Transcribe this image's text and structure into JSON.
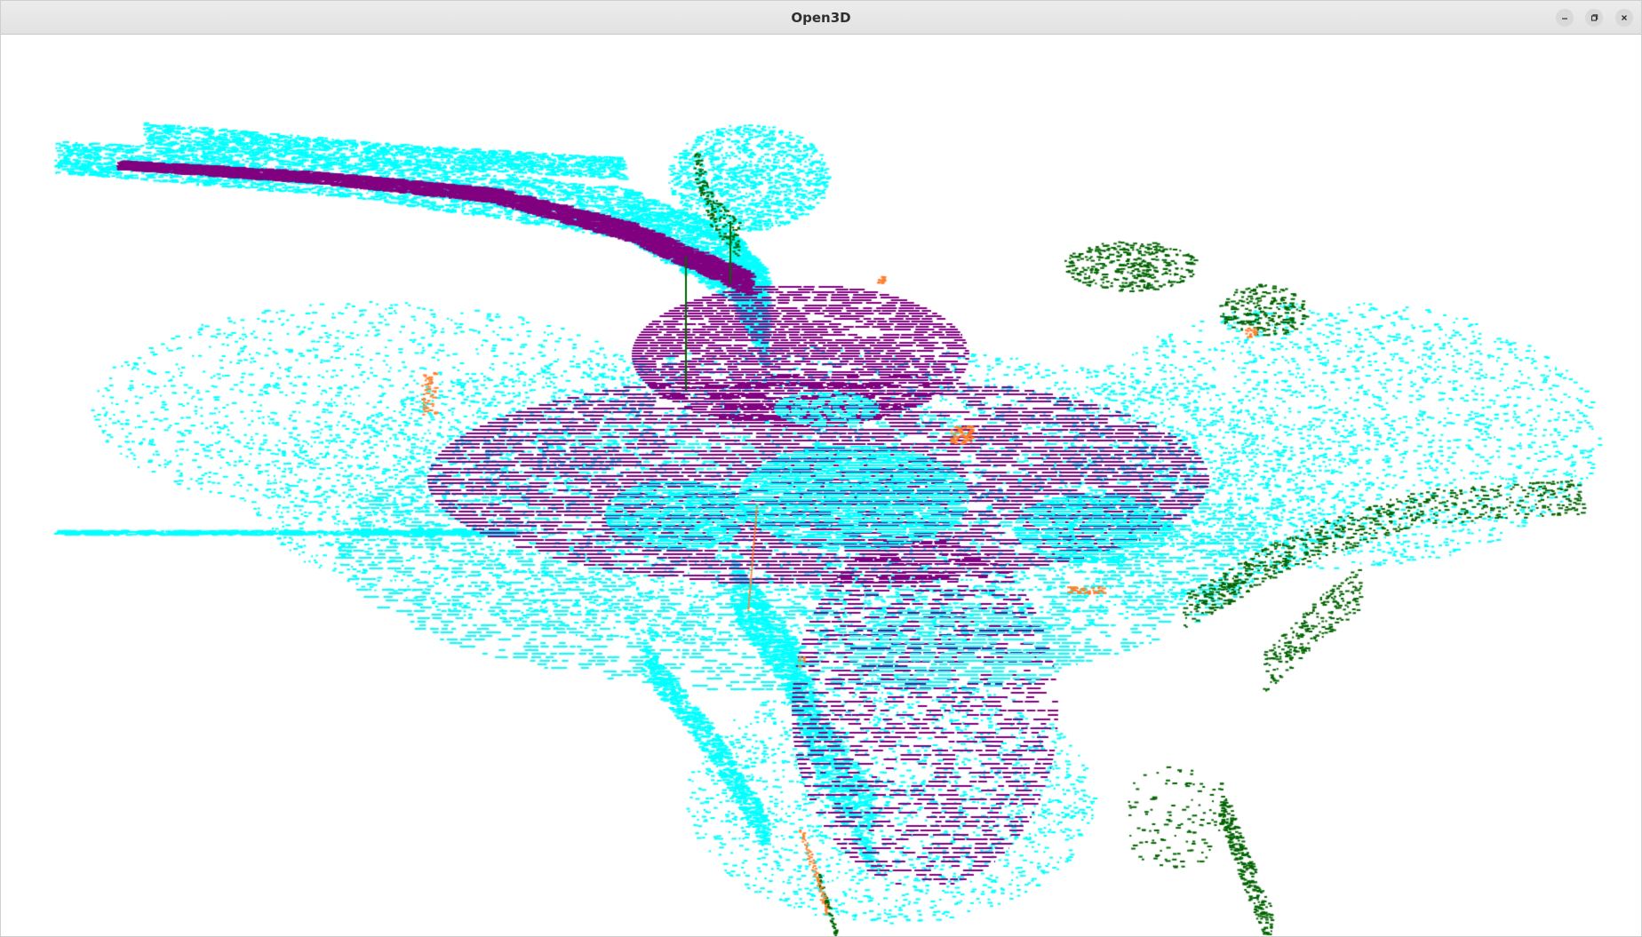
{
  "window": {
    "title": "Open3D",
    "controls": [
      {
        "name": "minimize",
        "icon": "minimize-icon"
      },
      {
        "name": "maximize",
        "icon": "restore-icon"
      },
      {
        "name": "close",
        "icon": "close-icon"
      }
    ]
  },
  "viewport": {
    "background": "#ffffff"
  },
  "point_cloud": {
    "colors": {
      "road_surface": "#800080",
      "ground_cyan": "#00ffff",
      "vegetation": "#006400",
      "poles_objects": "#ff7f2a"
    }
  }
}
